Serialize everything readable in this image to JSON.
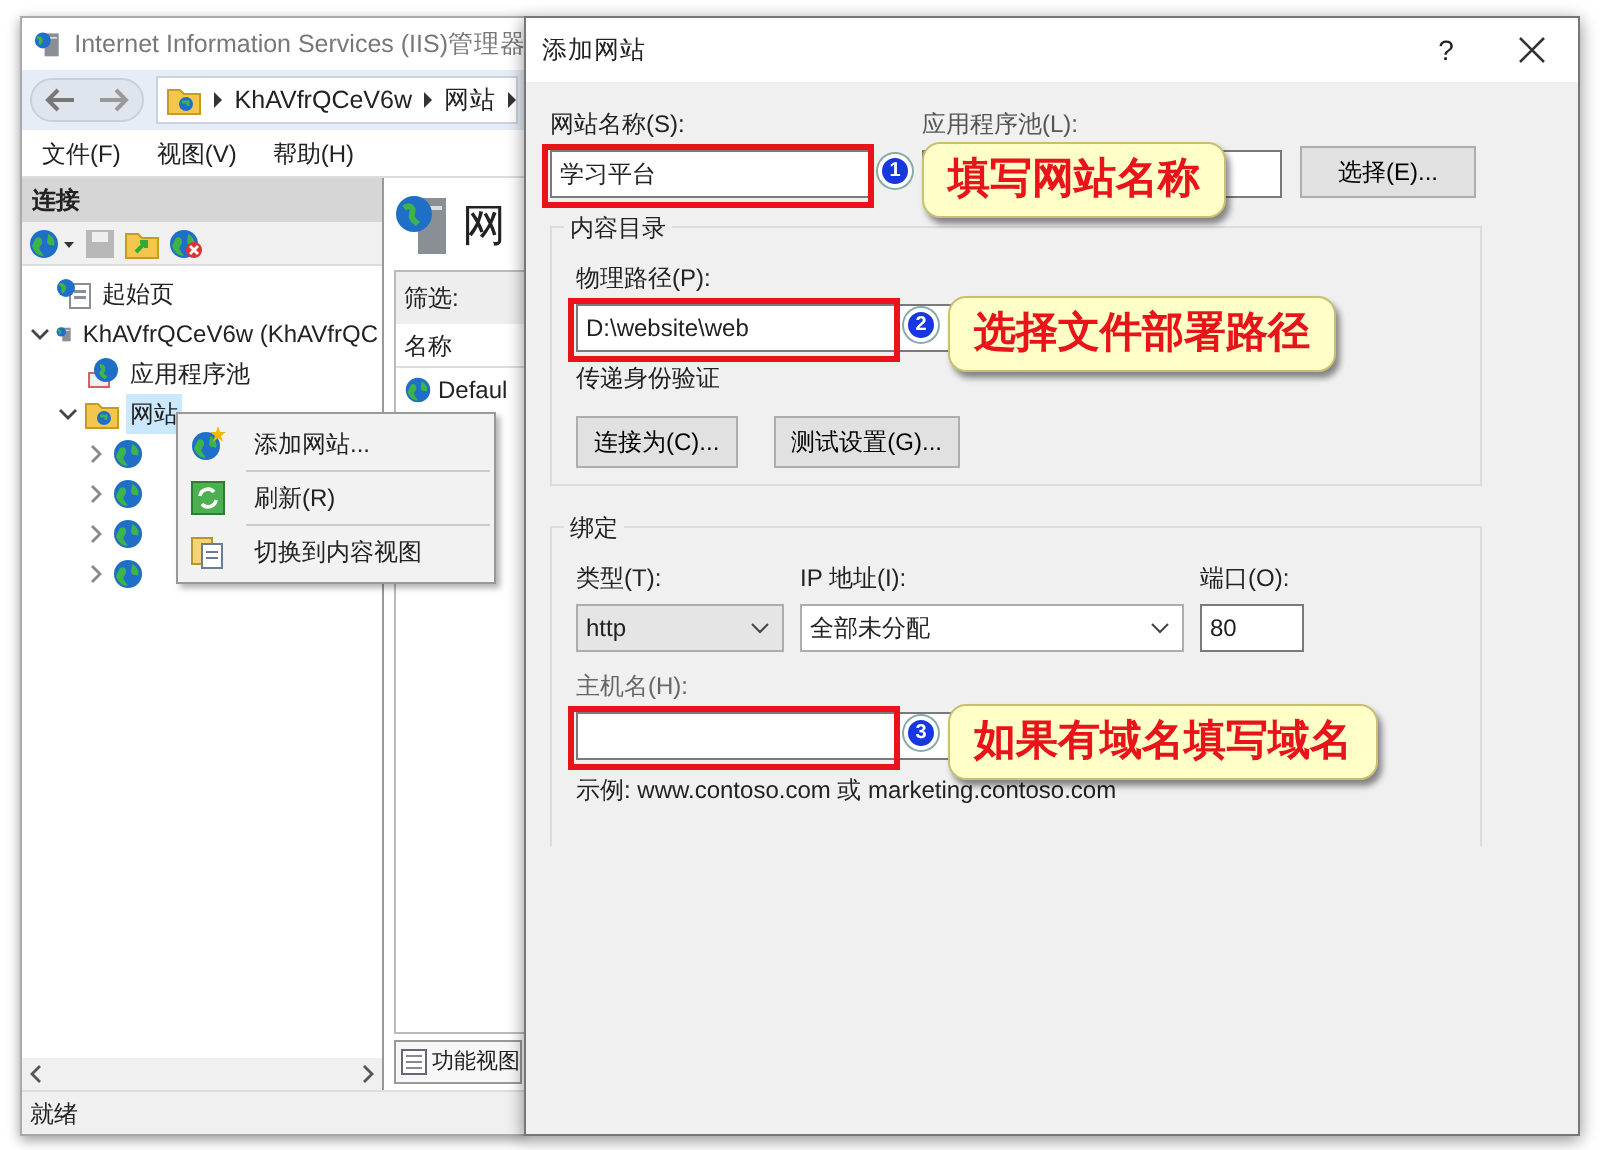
{
  "iis_window": {
    "title": "Internet Information Services (IIS)管理器",
    "breadcrumb": [
      "KhAVfrQCeV6w",
      "网站"
    ],
    "menu": [
      "文件(F)",
      "视图(V)",
      "帮助(H)"
    ],
    "connections": {
      "title": "连接",
      "tree": [
        {
          "label": "起始页",
          "kind": "start",
          "selected": false
        },
        {
          "label": "KhAVfrQCeV6w (KhAVfrQC",
          "kind": "server",
          "selected": false,
          "expanded": true,
          "children": [
            {
              "label": "应用程序池",
              "kind": "pool",
              "selected": false
            },
            {
              "label": "网站",
              "kind": "sites",
              "selected": true,
              "expanded": true,
              "children": [
                {
                  "kind": "site",
                  "selected": false,
                  "expanded": false
                },
                {
                  "kind": "site",
                  "selected": false,
                  "expanded": false
                },
                {
                  "kind": "site",
                  "selected": false,
                  "expanded": false
                },
                {
                  "kind": "site",
                  "selected": false,
                  "expanded": false
                }
              ]
            }
          ]
        }
      ]
    },
    "content": {
      "heading": "网",
      "filter_label": "筛选:",
      "column": "名称",
      "rows": [
        "Defaul"
      ],
      "view_tab": "功能视图"
    },
    "status_bar": "就绪"
  },
  "context_menu": [
    {
      "label": "添加网站...",
      "kind": "add"
    },
    {
      "label": "刷新(R)",
      "kind": "refresh"
    },
    {
      "label": "切换到内容视图",
      "kind": "switch"
    }
  ],
  "dialog": {
    "title": "添加网站",
    "help": "?",
    "site_name": {
      "label": "网站名称(S):",
      "value": "学习平台"
    },
    "app_pool": {
      "label": "应用程序池(L):"
    },
    "select_button": "选择(E)...",
    "content_directory": {
      "title": "内容目录",
      "path_label": "物理路径(P):",
      "path_value": "D:\\website\\web",
      "auth_label": "传递身份验证",
      "buttons": [
        "连接为(C)...",
        "测试设置(G)..."
      ]
    },
    "binding": {
      "title": "绑定",
      "type_label": "类型(T):",
      "type_value": "http",
      "ip_label": "IP 地址(I):",
      "ip_value": "全部未分配",
      "port_label": "端口(O):",
      "port_value": "80",
      "host_label": "主机名(H):",
      "example": "示例: www.contoso.com 或 marketing.contoso.com"
    }
  },
  "annotations": [
    {
      "number": "1",
      "text": "填写网站名称"
    },
    {
      "number": "2",
      "text": "选择文件部署路径"
    },
    {
      "number": "3",
      "text": "如果有域名填写域名"
    }
  ]
}
